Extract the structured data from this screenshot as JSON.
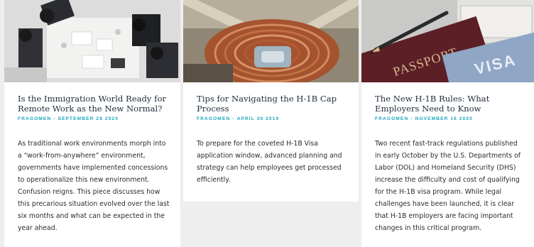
{
  "cards": [
    {
      "image": "meeting-overhead-photo",
      "title": "Is the Immigration World Ready for Remote Work as the New Normal?",
      "author": "FRAGOMEN",
      "separator": "-",
      "date": "SEPTEMBER 28 2020",
      "excerpt": "As traditional work environments morph into a “work-from-anywhere” environment, governments have implemented concessions to operationalize this new environment. Confusion reigns. This piece discusses how this precarious situation evolved over the last six months and what can be expected in the year ahead."
    },
    {
      "image": "rope-coil-photo",
      "title": "Tips for Navigating the H-1B Cap Process",
      "author": "FRAGOMEN",
      "separator": "-",
      "date": "APRIL 30 2019",
      "excerpt": "To prepare for the coveted H-1B Visa application window, advanced planning and strategy can help employees get processed efficiently."
    },
    {
      "image": "passport-visa-photo",
      "title": "The New H-1B Rules: What Employers Need to Know",
      "author": "FRAGOMEN",
      "separator": "-",
      "date": "NOVEMBER 16 2020",
      "excerpt": "Two recent fast-track regulations published in early October by the U.S. Departments of Labor (DOL) and Homeland Security (DHS) increase the difficulty and cost of qualifying for the H-1B visa program. While legal challenges have been launched, it is clear that H-1B employers are facing important changes in this critical program."
    }
  ],
  "image_text": {
    "passport": "PASSPORT",
    "visa": "VISA"
  },
  "colors": {
    "meta": "#16a6bd",
    "title": "#1f2b3a",
    "background": "#eeeeee",
    "card": "#ffffff"
  }
}
